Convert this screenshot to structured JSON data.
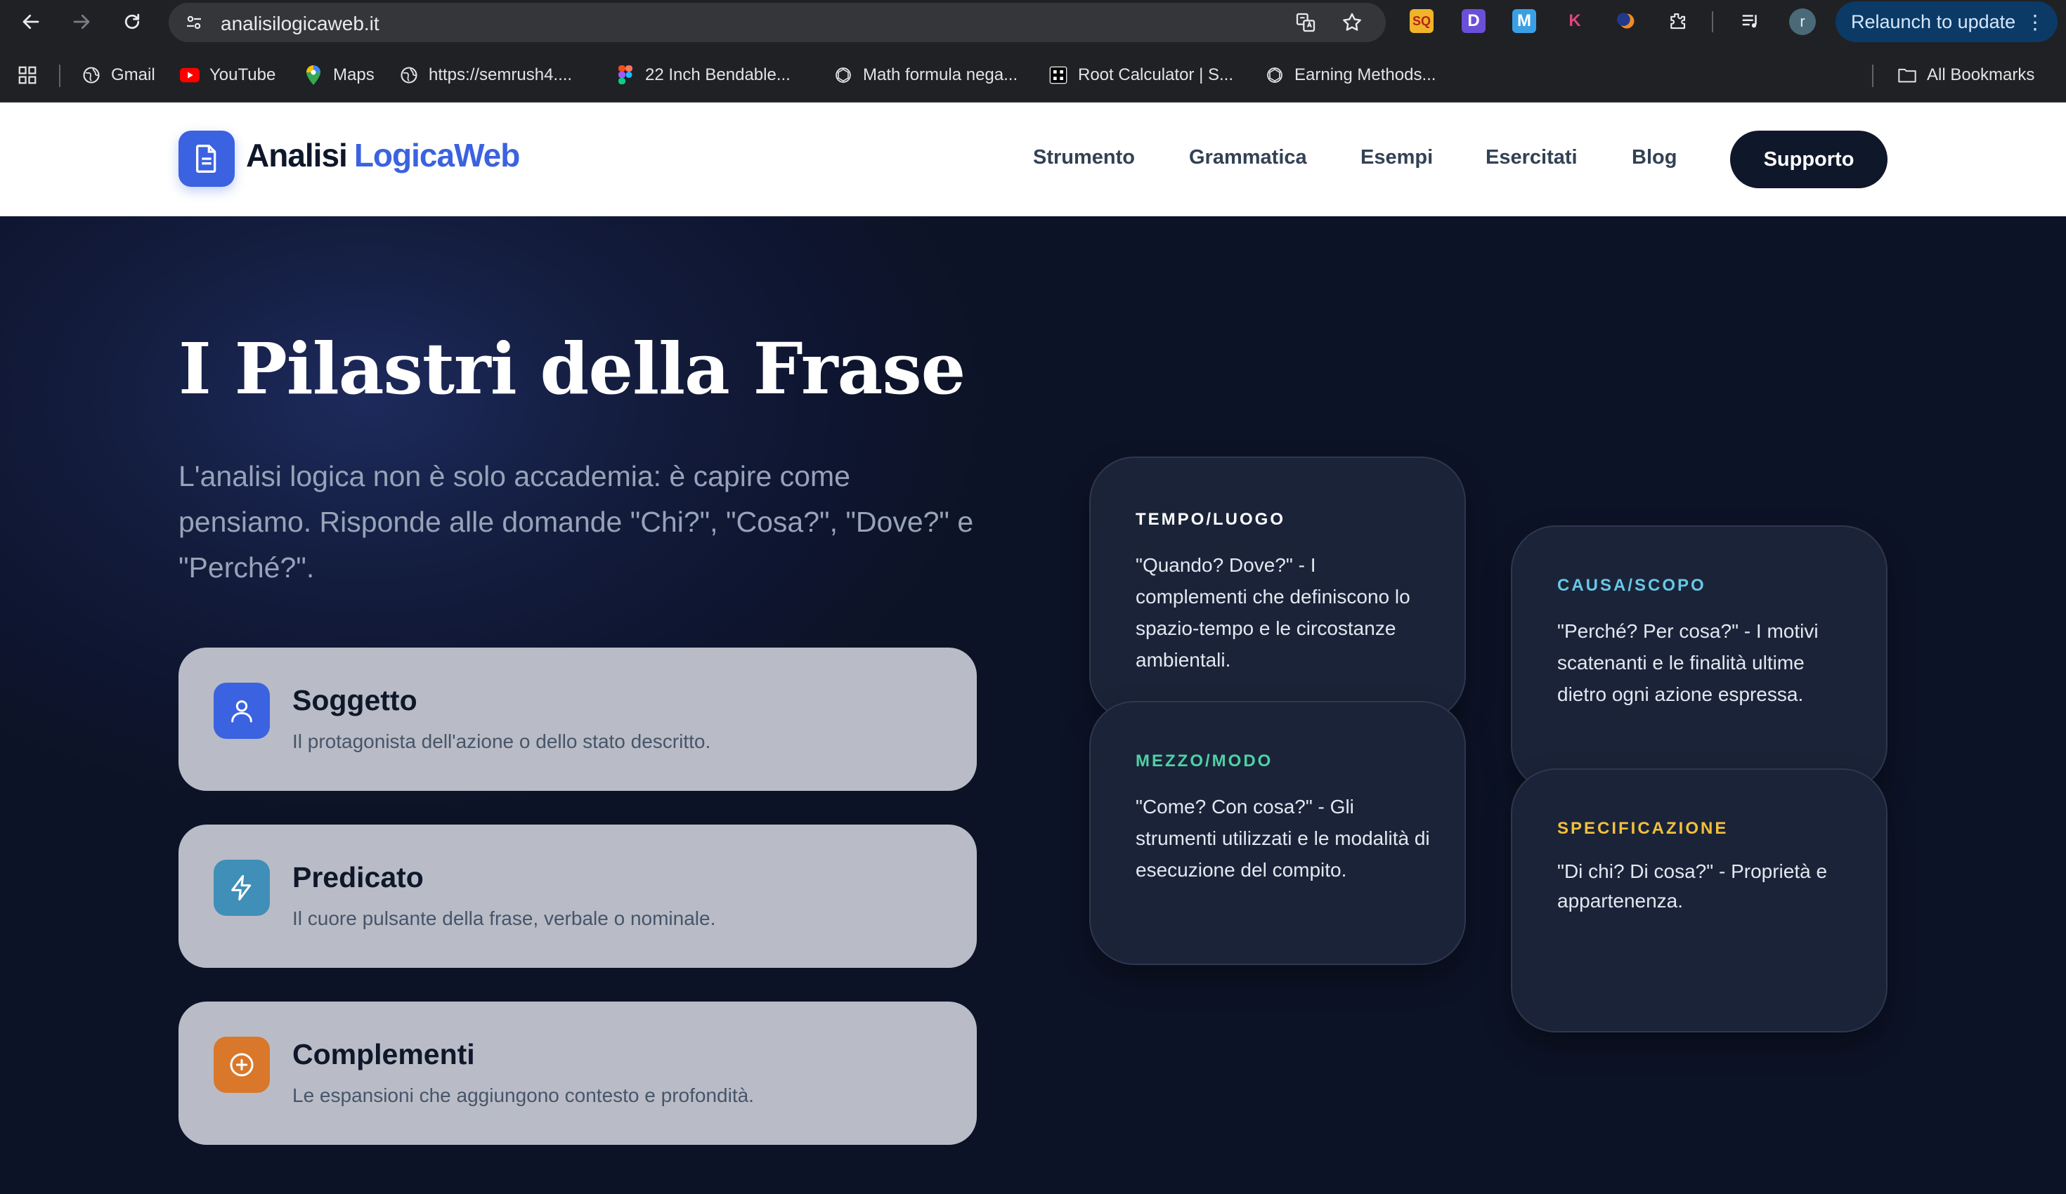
{
  "browser": {
    "url": "analisilogicaweb.it",
    "relaunch_label": "Relaunch to update",
    "profile_initial": "r",
    "bookmarks": [
      {
        "label": "Gmail",
        "icon": "globe-icon"
      },
      {
        "label": "YouTube",
        "icon": "youtube-icon"
      },
      {
        "label": "Maps",
        "icon": "maps-pin-icon"
      },
      {
        "label": "https://semrush4....",
        "icon": "globe-icon"
      },
      {
        "label": "22 Inch Bendable...",
        "icon": "figma-icon"
      },
      {
        "label": "Math formula nega...",
        "icon": "openai-icon"
      },
      {
        "label": "Root Calculator | S...",
        "icon": "calculator-icon"
      },
      {
        "label": "Earning Methods...",
        "icon": "openai-icon"
      }
    ],
    "all_bookmarks": "All Bookmarks"
  },
  "header": {
    "logo_part1": "Analisi",
    "logo_part2": "LogicaWeb",
    "nav": [
      "Strumento",
      "Grammatica",
      "Esempi",
      "Esercitati",
      "Blog"
    ],
    "support": "Supporto"
  },
  "hero": {
    "title": "I Pilastri della Frase",
    "subtitle": "L'analisi logica non è solo accademia: è capire come pensiamo. Risponde alle domande \"Chi?\", \"Cosa?\", \"Dove?\" e \"Perché?\".",
    "pillars": [
      {
        "title": "Soggetto",
        "desc": "Il protagonista dell'azione o dello stato descritto.",
        "icon": "user-icon",
        "color": "#3b62e0"
      },
      {
        "title": "Predicato",
        "desc": "Il cuore pulsante della frase, verbale o nominale.",
        "icon": "lightning-icon",
        "color": "#3f8fb8"
      },
      {
        "title": "Complementi",
        "desc": "Le espansioni che aggiungono contesto e profondità.",
        "icon": "plus-circle-icon",
        "color": "#d9782a"
      }
    ],
    "cards": [
      {
        "label": "TEMPO/LUOGO",
        "text": "\"Quando? Dove?\" - I complementi che definiscono lo spazio-tempo e le circostanze ambientali.",
        "color": "#ffffff"
      },
      {
        "label": "CAUSA/SCOPO",
        "text": "\"Perché? Per cosa?\" - I motivi scatenanti e le finalità ultime dietro ogni azione espressa.",
        "color": "#67c8e6"
      },
      {
        "label": "MEZZO/MODO",
        "text": "\"Come? Con cosa?\" - Gli strumenti utilizzati e le modalità di esecuzione del compito.",
        "color": "#4fd1a5"
      },
      {
        "label": "SPECIFICAZIONE",
        "text": "\"Di chi? Di cosa?\" - Proprietà e appartenenza.",
        "color": "#f2c13a"
      }
    ]
  }
}
